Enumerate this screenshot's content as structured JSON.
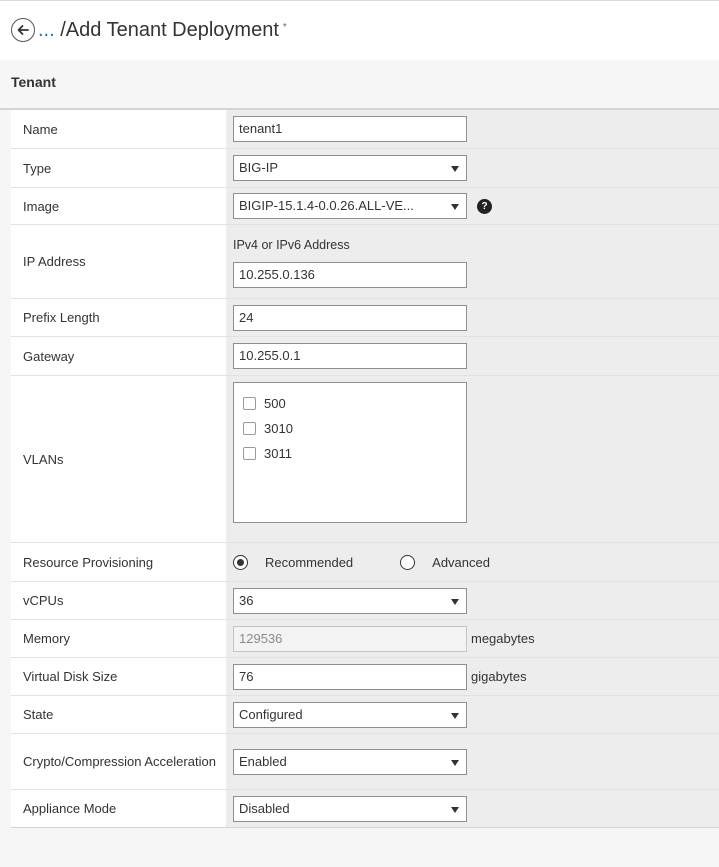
{
  "header": {
    "crumb_link": "...",
    "title": "/Add Tenant Deployment",
    "modified_marker": "*",
    "back_icon": "arrow-left-circle-icon"
  },
  "section": {
    "title": "Tenant"
  },
  "form": {
    "name": {
      "label": "Name",
      "value": "tenant1"
    },
    "type": {
      "label": "Type",
      "value": "BIG-IP"
    },
    "image": {
      "label": "Image",
      "value": "BIGIP-15.1.4-0.0.26.ALL-VE...",
      "help": "?"
    },
    "ip_address": {
      "label": "IP Address",
      "hint": "IPv4 or IPv6 Address",
      "value": "10.255.0.136"
    },
    "prefix_length": {
      "label": "Prefix Length",
      "value": "24"
    },
    "gateway": {
      "label": "Gateway",
      "value": "10.255.0.1"
    },
    "vlans": {
      "label": "VLANs",
      "options": [
        {
          "label": "500",
          "checked": false
        },
        {
          "label": "3010",
          "checked": false
        },
        {
          "label": "3011",
          "checked": false
        }
      ]
    },
    "resource_provisioning": {
      "label": "Resource Provisioning",
      "options": [
        "Recommended",
        "Advanced"
      ],
      "selected": "Recommended"
    },
    "vcpus": {
      "label": "vCPUs",
      "value": "36"
    },
    "memory": {
      "label": "Memory",
      "value": "129536",
      "unit": "megabytes",
      "disabled": true
    },
    "virtual_disk_size": {
      "label": "Virtual Disk Size",
      "value": "76",
      "unit": "gigabytes"
    },
    "state": {
      "label": "State",
      "value": "Configured"
    },
    "crypto": {
      "label": "Crypto/Compression Acceleration",
      "value": "Enabled"
    },
    "appliance_mode": {
      "label": "Appliance Mode",
      "value": "Disabled"
    }
  }
}
